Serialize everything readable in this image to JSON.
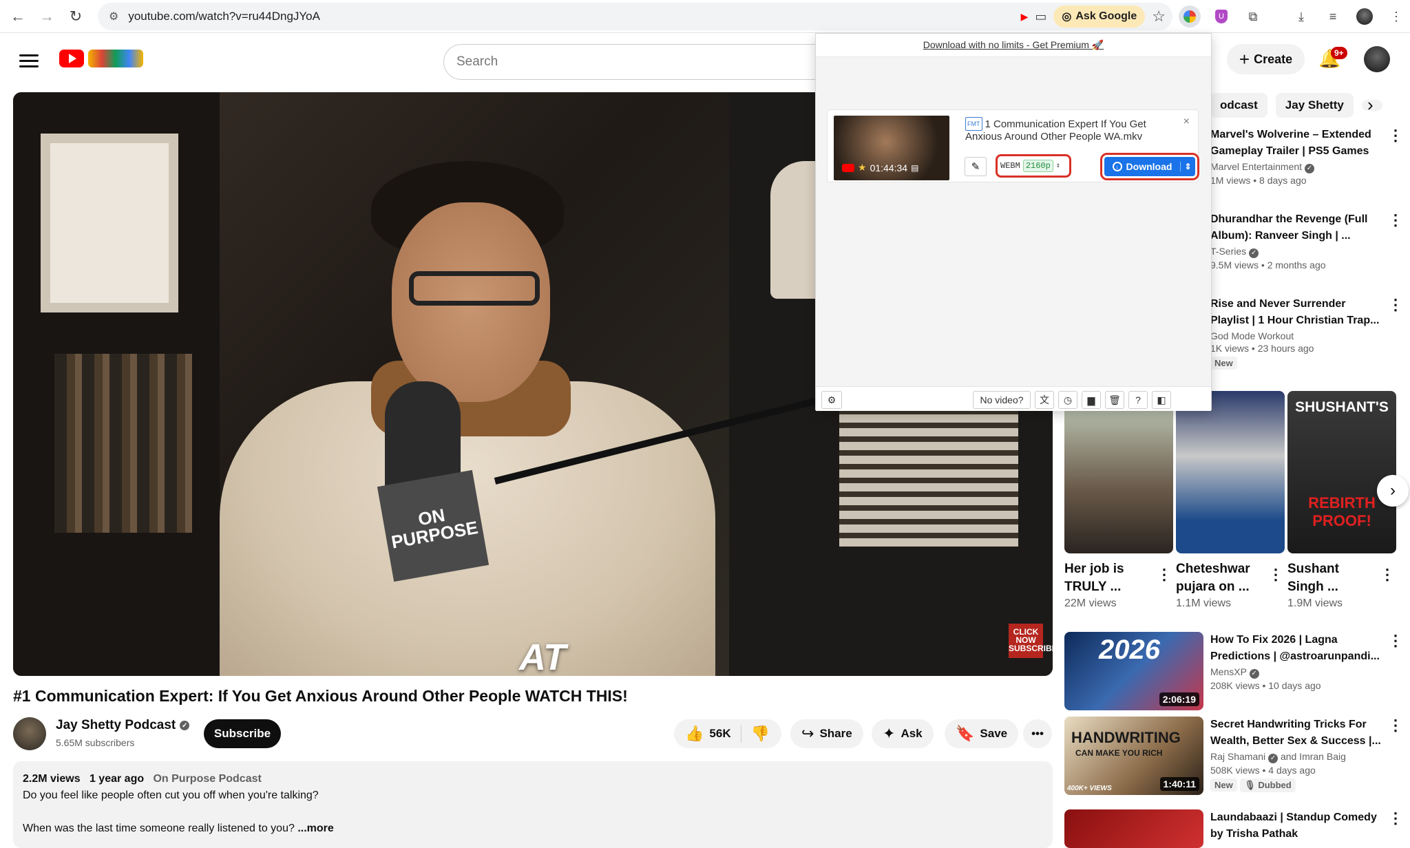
{
  "browser": {
    "url": "youtube.com/watch?v=ru44DngJYoA",
    "ask_google": "Ask Google"
  },
  "header": {
    "search_placeholder": "Search",
    "create_label": "Create",
    "notifications_count": "9+"
  },
  "video": {
    "caption_text": "AT",
    "click_now": "CLICK NOW SUBSCRIBE",
    "title": "#1 Communication Expert: If You Get Anxious Around Other People WATCH THIS!",
    "channel_name": "Jay Shetty Podcast",
    "subscribers": "5.65M subscribers",
    "subscribe_label": "Subscribe",
    "likes": "56K",
    "share_label": "Share",
    "ask_label": "Ask",
    "save_label": "Save",
    "views": "2.2M views",
    "age": "1 year ago",
    "desc_channel": "On Purpose Podcast",
    "desc_line1": "Do you feel like people often cut you off when you're talking?",
    "desc_line2": "When was the last time someone really listened to you?",
    "more_label": "...more"
  },
  "sidebar": {
    "chips": [
      "odcast",
      "Jay Shetty"
    ],
    "items": [
      {
        "title1": "Marvel's Wolverine – Extended",
        "title2": "Gameplay Trailer | PS5 Games",
        "channel": "Marvel Entertainment",
        "meta": "1M views • 8 days ago"
      },
      {
        "title1": "Dhurandhar the Revenge (Full",
        "title2": "Album): Ranveer Singh | ...",
        "channel": "T-Series",
        "meta": "9.5M views • 2 months ago"
      },
      {
        "title1": "Rise and Never Surrender",
        "title2": "Playlist | 1 Hour Christian Trap...",
        "channel": "God Mode Workout",
        "meta": "1K views • 23 hours ago",
        "tag": "New"
      },
      {
        "title1": "How To Fix 2026 | Lagna",
        "title2": "Predictions | @astroarunpandi...",
        "channel": "MensXP",
        "meta": "208K views • 10 days ago",
        "duration": "2:06:19",
        "thumb_text": "2026"
      },
      {
        "title1": "Secret Handwriting Tricks For",
        "title2": "Wealth, Better Sex & Success |...",
        "channel": "Raj Shamani",
        "channel_extra": "and Imran Baig",
        "meta": "508K views • 4 days ago",
        "tag": "New",
        "tag2": "Dubbed",
        "duration": "1:40:11",
        "thumb_text": "HANDWRITING",
        "thumb_sub": "CAN MAKE YOU RICH",
        "thumb_views": "400K+ VIEWS"
      },
      {
        "title1": "Laundabaazi | Standup Comedy",
        "title2": "by Trisha Pathak"
      }
    ],
    "shorts": [
      {
        "line1": "Her job is",
        "line2": "TRULY ...",
        "views": "22M views"
      },
      {
        "line1": "Cheteshwar",
        "line2": "pujara on ...",
        "views": "1.1M views"
      },
      {
        "line1": "Sushant",
        "line2": "Singh ...",
        "views": "1.9M views",
        "thumb_text1": "SHUSHANT'S",
        "thumb_text2": "REBIRTH PROOF!"
      }
    ]
  },
  "extension": {
    "promo": "Download with no limits - Get Premium 🚀",
    "fmt_tag": "FMT",
    "file_title": "1 Communication Expert If You Get Anxious Around Other People WA.mkv",
    "duration": "01:44:34",
    "format": "WEBM",
    "resolution": "2160p",
    "download_label": "Download",
    "no_video": "No video?"
  }
}
